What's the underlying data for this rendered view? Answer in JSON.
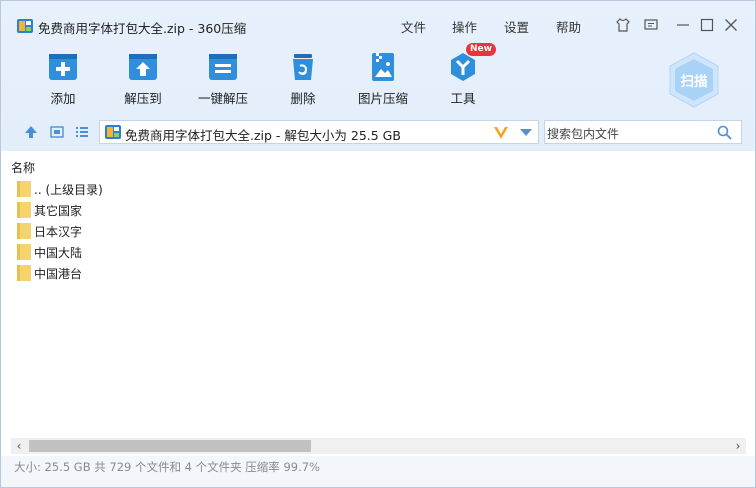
{
  "window": {
    "title": "免费商用字体打包大全.zip - 360压缩",
    "menu": [
      "文件",
      "操作",
      "设置",
      "帮助"
    ]
  },
  "toolbar": {
    "items": [
      {
        "label": "添加",
        "icon": "add-icon"
      },
      {
        "label": "解压到",
        "icon": "extract-to-icon"
      },
      {
        "label": "一键解压",
        "icon": "one-click-extract-icon"
      },
      {
        "label": "删除",
        "icon": "delete-icon"
      },
      {
        "label": "图片压缩",
        "icon": "image-compress-icon"
      },
      {
        "label": "工具",
        "icon": "tools-icon"
      }
    ],
    "new_badge": "New",
    "scan_label": "扫描"
  },
  "address": {
    "path": "免费商用字体打包大全.zip - 解包大小为 25.5 GB"
  },
  "search": {
    "placeholder": "搜索包内文件"
  },
  "list": {
    "column_name": "名称",
    "items": [
      ".. (上级目录)",
      "其它国家",
      "日本汉字",
      "中国大陆",
      "中国港台"
    ]
  },
  "status": {
    "text": "大小: 25.5 GB 共 729 个文件和 4 个文件夹 压缩率 99.7%"
  },
  "colors": {
    "accent": "#2f8fdc",
    "folder": "#f5d46e",
    "badge": "#e8343a"
  }
}
